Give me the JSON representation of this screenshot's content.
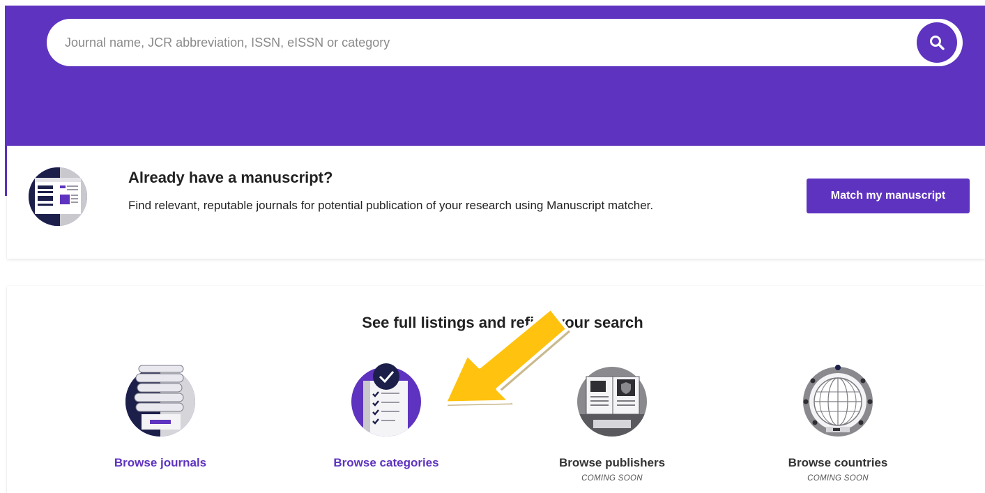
{
  "search": {
    "placeholder": "Journal name, JCR abbreviation, ISSN, eISSN or category",
    "button_icon": "search-icon"
  },
  "manuscript": {
    "title": "Already have a manuscript?",
    "description": "Find relevant, reputable journals for potential publication of your research using Manuscript matcher.",
    "button_label": "Match my manuscript"
  },
  "browse": {
    "heading": "See full listings and refine your search",
    "items": [
      {
        "label": "Browse journals",
        "note": "",
        "icon": "journals-icon"
      },
      {
        "label": "Browse categories",
        "note": "",
        "icon": "categories-icon"
      },
      {
        "label": "Browse publishers",
        "note": "COMING SOON",
        "icon": "publishers-icon"
      },
      {
        "label": "Browse countries",
        "note": "COMING SOON",
        "icon": "countries-icon"
      }
    ]
  },
  "colors": {
    "brand": "#5e33bf",
    "arrow": "#ffc20e"
  }
}
